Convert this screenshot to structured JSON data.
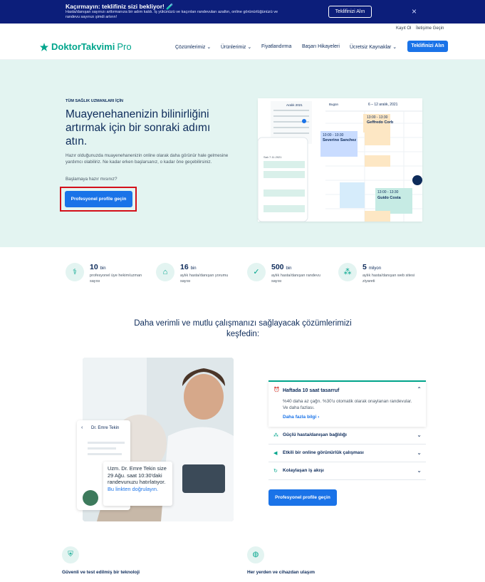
{
  "banner": {
    "title": "Kaçırmayın: teklifiniz sizi bekliyor! 🧪",
    "text": "Hasta/danışan sayınızı arttırmanıza bir adım kaldı. İş yükünüzü ve kaçırılan randevuları azaltın, online görünürlüğünüzü ve randevu sayınızı şimdi artırın!",
    "button": "Teklifinizi Alın",
    "close": "×"
  },
  "toplinks": {
    "login": "Kayıt Ol",
    "contact": "İletişime Geçin"
  },
  "nav": {
    "logo_main": "DoktorTakvimi",
    "logo_pro": "Pro",
    "items": [
      "Çözümlerimiz ⌄",
      "Ürünlerimiz ⌄",
      "Fiyatlandırma",
      "Başarı Hikayeleri",
      "Ücretsiz Kaynaklar ⌄"
    ],
    "cta": "Teklifinizi Alın"
  },
  "hero": {
    "eyebrow": "TÜM SAĞLIK UZMANLARI İÇİN",
    "title": "Muayenehanenizin bilinirliğini artırmak için bir sonraki adımı atın.",
    "text": "Hazır olduğunuzda muayenehanenizin online olarak daha görünür hale gelmesine yardımcı olabiliriz. Ne kadar erken başlarsanız, o kadar öne geçebilirsiniz.",
    "question": "Başlamaya hazır mısınız?",
    "cta": "Profesyonel profile geçin"
  },
  "mock": {
    "month": "Aralık 2021",
    "range": "6 – 12 aralık, 2021",
    "today": "Bugün",
    "b1_time": "13:00 - 13:30",
    "b1_name": "Geffredo Corb",
    "b2_time": "10:00 - 10:30",
    "b2_name": "Severino Sanchez",
    "b3_time": "13:00 - 13:30",
    "b3_name": "Guido Costa",
    "phone_date": "Salı 7.11.2021"
  },
  "stats": [
    {
      "num": "10",
      "unit": "bin",
      "label": "profesyonel üye hekim/uzman sayısı",
      "icon": "stethoscope-icon"
    },
    {
      "num": "16",
      "unit": "bin",
      "label": "aylık hasta/danışan yorumu sayısı",
      "icon": "house-plus-icon"
    },
    {
      "num": "500",
      "unit": "bin",
      "label": "aylık hasta/danışan randevu sayısı",
      "icon": "calendar-check-icon"
    },
    {
      "num": "5",
      "unit": "milyon",
      "label": "aylık hasta/danışan web sitesi ziyareti",
      "icon": "people-icon"
    }
  ],
  "section": {
    "title": "Daha verimli ve mutlu çalışmanızı sağlayacak çözümlerimizi keşfedin:"
  },
  "card": {
    "doctor": "Dr. Emre Tekin",
    "message": "Uzm. Dr. Emre Tekin size 29 Ağu. saat 10:30'daki randevunuzu hatırlatıyor.",
    "link": "Bu linkten doğrulayın."
  },
  "accordion": {
    "open_title": "Haftada 10 saat tasarruf",
    "open_text": "%40 daha az çağrı. %30'u otomatik olarak onaylanan randevular. Ve daha fazlası.",
    "more": "Daha fazla bilgi",
    "items": [
      "Güçlü hasta/danışan bağlılığı",
      "Etkili bir online görünürlük çalışması",
      "Kolaylaşan iş akışı"
    ]
  },
  "cta2": "Profesyonel profile geçin",
  "features": [
    {
      "label": "Güvenli ve test edilmiş bir teknoloji",
      "icon": "shield-icon"
    },
    {
      "label": "Her yerden ve cihazdan ulaşım",
      "icon": "globe-icon"
    }
  ],
  "colors": {
    "accent": "#1a73e8",
    "brand": "#00a58c",
    "banner": "#0c1e7a",
    "hero_bg": "#e3f4f1",
    "highlight": "#d4101a"
  }
}
